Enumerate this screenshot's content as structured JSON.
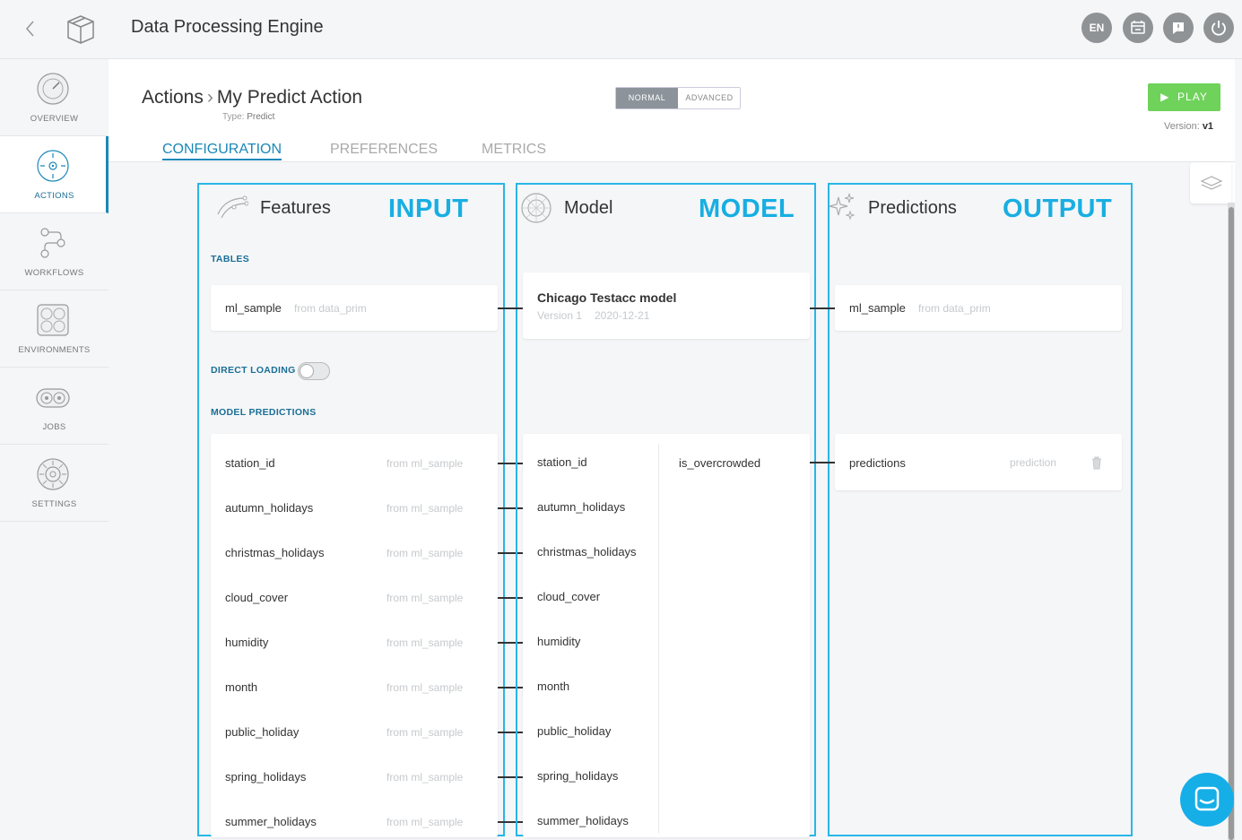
{
  "app": {
    "title": "Data Processing Engine"
  },
  "topbar": {
    "lang": "EN"
  },
  "sidebar": {
    "items": [
      {
        "label": "OVERVIEW",
        "icon": "dashboard-gauge-icon"
      },
      {
        "label": "ACTIONS",
        "icon": "target-icon",
        "active": true
      },
      {
        "label": "WORKFLOWS",
        "icon": "workflow-icon"
      },
      {
        "label": "ENVIRONMENTS",
        "icon": "environment-icon"
      },
      {
        "label": "JOBS",
        "icon": "jobs-gears-icon"
      },
      {
        "label": "SETTINGS",
        "icon": "settings-gear-icon"
      }
    ]
  },
  "header": {
    "breadcrumb_root": "Actions",
    "breadcrumb_current": "My Predict Action",
    "type_label": "Type:",
    "type_value": "Predict",
    "mode_normal": "NORMAL",
    "mode_advanced": "ADVANCED",
    "play_label": "PLAY",
    "version_label": "Version:",
    "version_value": "v1"
  },
  "tabs": [
    "CONFIGURATION",
    "PREFERENCES",
    "METRICS"
  ],
  "input": {
    "title": "Features",
    "tag": "INPUT",
    "tables_label": "TABLES",
    "table_name": "ml_sample",
    "table_source": "from data_prim",
    "direct_loading_label": "DIRECT LOADING",
    "direct_loading_on": false,
    "model_predictions_label": "MODEL PREDICTIONS",
    "features": [
      {
        "name": "station_id",
        "source": "from ml_sample"
      },
      {
        "name": "autumn_holidays",
        "source": "from ml_sample"
      },
      {
        "name": "christmas_holidays",
        "source": "from ml_sample"
      },
      {
        "name": "cloud_cover",
        "source": "from ml_sample"
      },
      {
        "name": "humidity",
        "source": "from ml_sample"
      },
      {
        "name": "month",
        "source": "from ml_sample"
      },
      {
        "name": "public_holiday",
        "source": "from ml_sample"
      },
      {
        "name": "spring_holidays",
        "source": "from ml_sample"
      },
      {
        "name": "summer_holidays",
        "source": "from ml_sample"
      }
    ]
  },
  "model": {
    "title": "Model",
    "tag": "MODEL",
    "model_name": "Chicago Testacc model",
    "model_version": "Version 1",
    "model_date": "2020-12-21",
    "inputs": [
      "station_id",
      "autumn_holidays",
      "christmas_holidays",
      "cloud_cover",
      "humidity",
      "month",
      "public_holiday",
      "spring_holidays",
      "summer_holidays"
    ],
    "output": "is_overcrowded"
  },
  "output": {
    "title": "Predictions",
    "tag": "OUTPUT",
    "table_name": "ml_sample",
    "table_source": "from data_prim",
    "prediction_name": "predictions",
    "prediction_type": "prediction"
  },
  "colors": {
    "accent": "#1a88b8",
    "highlight": "#18aee2",
    "play": "#6fd25a"
  }
}
